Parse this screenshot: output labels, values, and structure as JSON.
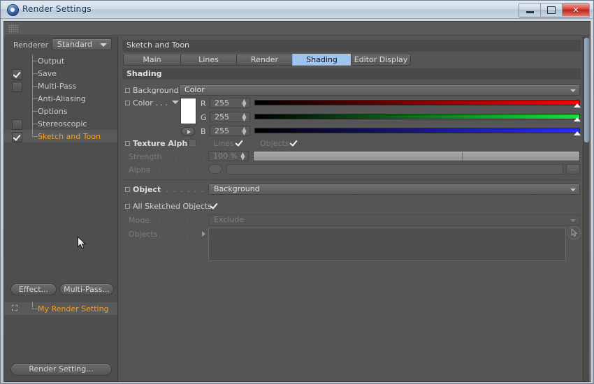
{
  "window": {
    "title": "Render Settings",
    "icon": "cinema4d-logo-icon",
    "buttons": {
      "minimize": "minimize-icon",
      "maximize": "maximize-icon",
      "close": "✕"
    }
  },
  "left_panel": {
    "renderer_label": "Renderer",
    "renderer_value": "Standard",
    "tree": [
      {
        "label": "Output",
        "check": "none",
        "selected": false
      },
      {
        "label": "Save",
        "check": "checked",
        "selected": false
      },
      {
        "label": "Multi-Pass",
        "check": "unchecked",
        "selected": false
      },
      {
        "label": "Anti-Aliasing",
        "check": "none",
        "selected": false
      },
      {
        "label": "Options",
        "check": "none",
        "selected": false
      },
      {
        "label": "Stereoscopic",
        "check": "unchecked",
        "selected": false
      },
      {
        "label": "Sketch and Toon",
        "check": "checked",
        "selected": true
      }
    ],
    "buttons": {
      "effect": "Effect...",
      "multipass": "Multi-Pass..."
    },
    "render_setting_item": "My Render Setting",
    "render_setting_button": "Render Setting..."
  },
  "right_panel": {
    "section_title": "Sketch and Toon",
    "tabs": [
      {
        "label": "Main",
        "active": false,
        "width": 82
      },
      {
        "label": "Lines",
        "active": false,
        "width": 80
      },
      {
        "label": "Render",
        "active": false,
        "width": 80
      },
      {
        "label": "Shading",
        "active": true,
        "width": 84
      },
      {
        "label": "Editor Display",
        "active": false,
        "width": 86
      }
    ],
    "group_header": "Shading",
    "background": {
      "label": "Background",
      "value": "Color"
    },
    "color": {
      "label": "Color . . .",
      "swatch_hex": "#ffffff",
      "channels": [
        {
          "name": "R",
          "value": "255",
          "gradient_to": "#ff0000"
        },
        {
          "name": "G",
          "value": "255",
          "gradient_to": "#19e23a"
        },
        {
          "name": "B",
          "value": "255",
          "gradient_to": "#2b2bff"
        }
      ]
    },
    "texture_alpha": {
      "label": "Texture Alpha",
      "checked": false,
      "lines_label": "Lines",
      "lines_checked": true,
      "objects_label": "Objects",
      "objects_checked": true
    },
    "strength": {
      "label": "Strength",
      "dots": ". . . . . . . . . .",
      "value": "100 %"
    },
    "alpha": {
      "label": "Alpha",
      "dots": ". . . . . . . . . . . .",
      "value": ""
    },
    "object": {
      "label": "Object",
      "dots": ". . . . . . . . . . .",
      "value": "Background"
    },
    "all_sketched_objects": {
      "label": "All Sketched Objects",
      "checked": true
    },
    "mode": {
      "label": "Mode",
      "dots": ". . . . . . . . . . . .",
      "value": "Exclude"
    },
    "objects": {
      "label": "Objects",
      "dots": ". . . . . . . . .",
      "value": ""
    }
  }
}
